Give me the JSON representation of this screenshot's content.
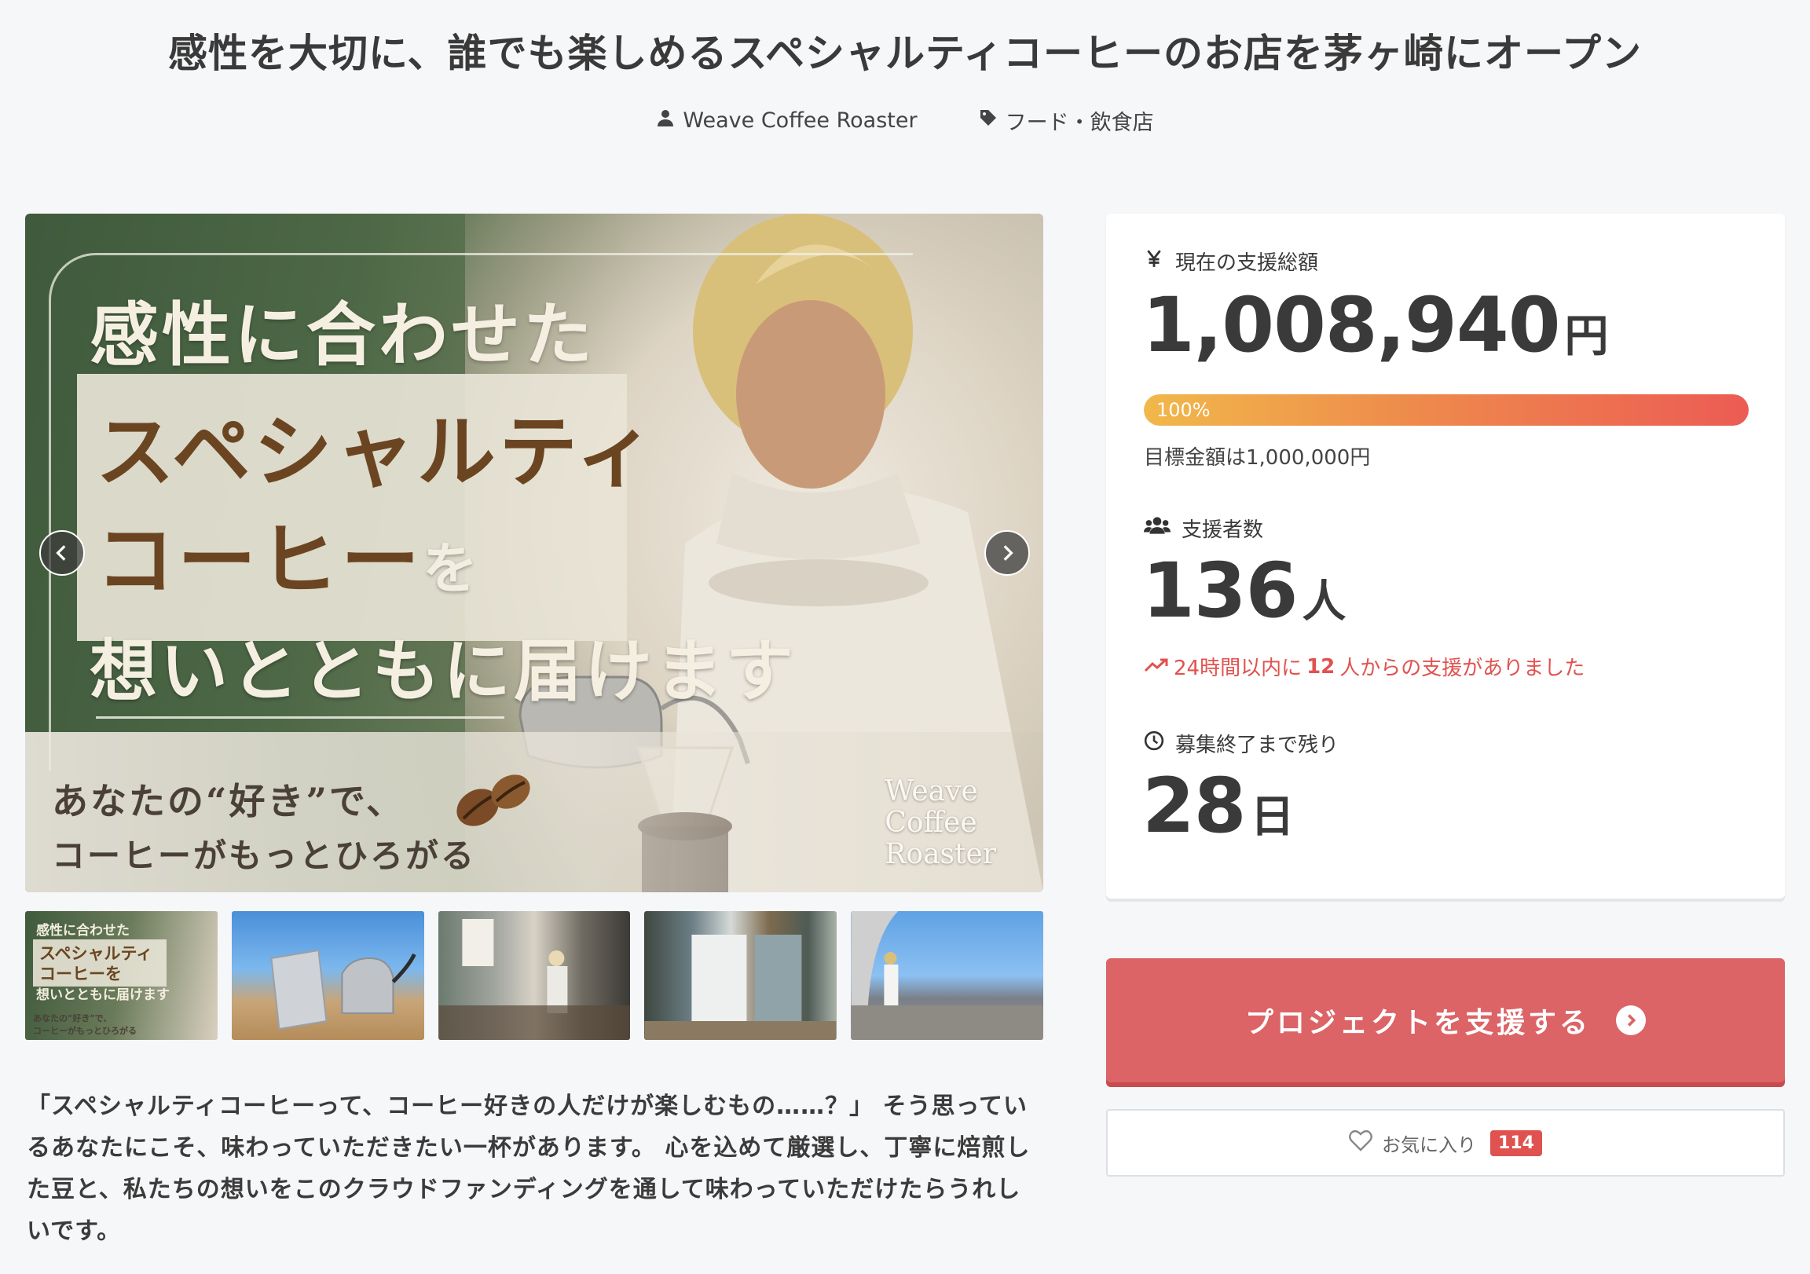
{
  "page": {
    "title": "感性を大切に、誰でも楽しめるスペシャルティコーヒーのお店を茅ヶ崎にオープン",
    "owner": "Weave Coffee Roaster",
    "category": "フード・飲食店"
  },
  "hero": {
    "line1": "感性に合わせた",
    "line2": "スペシャルティ",
    "line3_main": "コーヒー",
    "line3_particle": "を",
    "line4": "想いとともに届けます",
    "tagline1": "あなたの“好き”で、",
    "tagline2": "コーヒーがもっとひろがる",
    "brand_line1": "Weave",
    "brand_line2": "Coffee",
    "brand_line3": "Roaster"
  },
  "thumbnails": {
    "thumb1_line1": "感性に合わせた",
    "thumb1_line2": "スペシャルティ",
    "thumb1_line3": "コーヒーを",
    "thumb1_line4": "想いとともに届けます",
    "thumb1_line5": "あなたの“好き”で、",
    "thumb1_line6": "コーヒーがもっとひろがる"
  },
  "description": "「スペシャルティコーヒーって、コーヒー好きの人だけが楽しむもの……？」 そう思っているあなたにこそ、味わっていただきたい一杯があります。 心を込めて厳選し、丁寧に焙煎した豆と、私たちの想いをこのクラウドファンディングを通して味わっていただけたらうれしいです。",
  "stats": {
    "amount_label": "現在の支援総額",
    "amount_value": "1,008,940",
    "amount_unit": "円",
    "progress_text": "100%",
    "progress_fraction": 1.0,
    "goal_text": "目標金額は1,000,000円",
    "supporters_label": "支援者数",
    "supporters_value": "136",
    "supporters_unit": "人",
    "trend_prefix": "24時間以内に",
    "trend_count": "12",
    "trend_suffix": "人からの支援がありました",
    "remaining_label": "募集終了まで残り",
    "remaining_value": "28",
    "remaining_unit": "日"
  },
  "actions": {
    "support_label": "プロジェクトを支援する",
    "favorite_label": "お気に入り",
    "favorite_count": "114"
  },
  "colors": {
    "accent": "#dc6366",
    "trend": "#e0524f",
    "progress_start": "#f1b84a",
    "progress_end": "#ec5b54"
  }
}
